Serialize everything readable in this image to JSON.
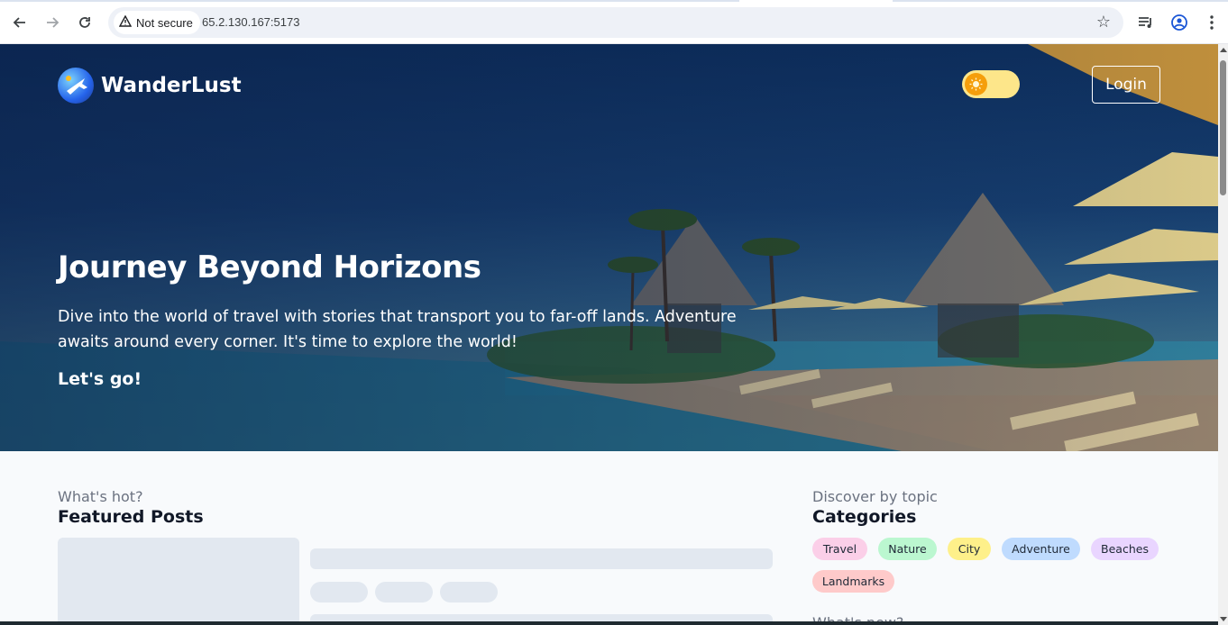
{
  "browser": {
    "security_label": "Not secure",
    "url": "65.2.130.167:5173",
    "icons": [
      "back-arrow-icon",
      "forward-arrow-icon",
      "reload-icon",
      "warning-icon",
      "star-icon",
      "media-controls-icon",
      "profile-icon",
      "more-vert-icon"
    ]
  },
  "header": {
    "brand": "WanderLust",
    "login_label": "Login",
    "theme_toggle_state": "light"
  },
  "hero": {
    "title": "Journey Beyond Horizons",
    "subtitle": "Dive into the world of travel with stories that transport you to far-off lands. Adventure awaits around every corner. It's time to explore the world!",
    "cta": "Let's go!"
  },
  "featured": {
    "eyebrow": "What's hot?",
    "title": "Featured Posts"
  },
  "categories": {
    "eyebrow": "Discover by topic",
    "title": "Categories",
    "items": [
      {
        "label": "Travel",
        "color": "#fbcfe8"
      },
      {
        "label": "Nature",
        "color": "#bbf7d0"
      },
      {
        "label": "City",
        "color": "#fef08a"
      },
      {
        "label": "Adventure",
        "color": "#bfdbfe"
      },
      {
        "label": "Beaches",
        "color": "#e9d5ff"
      },
      {
        "label": "Landmarks",
        "color": "#fecaca"
      }
    ],
    "next_eyebrow": "What's new?"
  }
}
